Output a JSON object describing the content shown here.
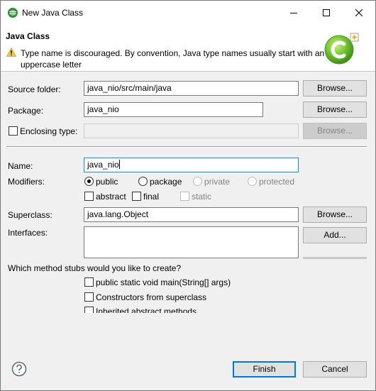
{
  "window": {
    "title": "New Java Class"
  },
  "header": {
    "title": "Java Class",
    "warning": "Type name is discouraged. By convention, Java type names usually start with an uppercase letter"
  },
  "form": {
    "source_folder": {
      "label": "Source folder:",
      "value": "java_nio/src/main/java",
      "browse": "Browse..."
    },
    "package": {
      "label": "Package:",
      "value": "java_nio",
      "browse": "Browse..."
    },
    "enclosing_type": {
      "label": "Enclosing type:",
      "value": "",
      "browse": "Browse...",
      "checked": false
    },
    "name": {
      "label": "Name:",
      "value": "java_nio"
    },
    "modifiers": {
      "label": "Modifiers:",
      "visibility": [
        "public",
        "package",
        "private",
        "protected"
      ],
      "selected": "public",
      "abstract": "abstract",
      "final": "final",
      "static": "static"
    },
    "superclass": {
      "label": "Superclass:",
      "value": "java.lang.Object",
      "browse": "Browse..."
    },
    "interfaces": {
      "label": "Interfaces:",
      "add": "Add..."
    },
    "stubs": {
      "question": "Which method stubs would you like to create?",
      "main": "public static void main(String[] args)",
      "constructors": "Constructors from superclass",
      "inherited": "Inherited abstract methods"
    }
  },
  "footer": {
    "finish": "Finish",
    "cancel": "Cancel"
  },
  "icons": {
    "app": "eclipse-logo-icon",
    "warning": "warning-triangle-icon",
    "banner": "new-class-wizard-banner",
    "help": "help-question-icon"
  },
  "colors": {
    "focus_border": "#3c7fb1",
    "primary_button_border": "#0078d7",
    "banner_green": "#6cbf2c",
    "warning_yellow": "#f2c94c"
  }
}
